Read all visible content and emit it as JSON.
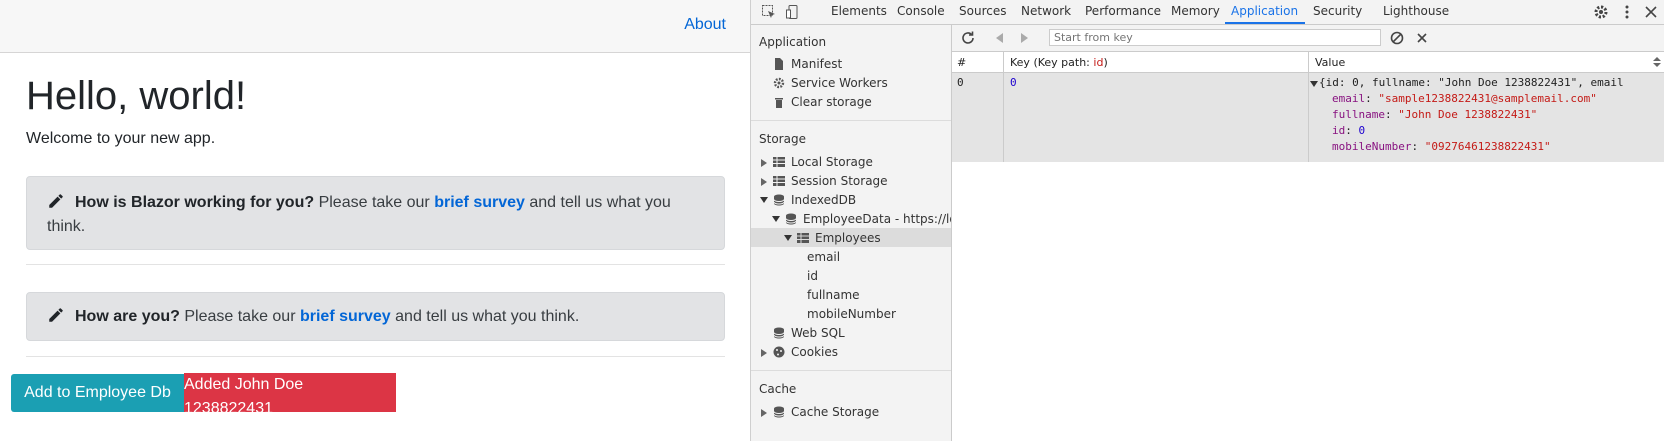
{
  "app": {
    "nav_about": "About",
    "heading": "Hello, world!",
    "welcome": "Welcome to your new app.",
    "alerts": [
      {
        "question": "How is Blazor working for you?",
        "pre": " Please take our ",
        "link": "brief survey",
        "post": " and tell us what you think."
      },
      {
        "question": "How are you?",
        "pre": " Please take our ",
        "link": "brief survey",
        "post": " and tell us what you think."
      }
    ],
    "add_button": "Add to Employee Db",
    "added_message": "Added John Doe 1238822431"
  },
  "devtools": {
    "tabs": [
      "Elements",
      "Console",
      "Sources",
      "Network",
      "Performance",
      "Memory",
      "Application",
      "Security",
      "Lighthouse"
    ],
    "active_tab": "Application",
    "sidebar": {
      "application_title": "Application",
      "application_items": [
        "Manifest",
        "Service Workers",
        "Clear storage"
      ],
      "storage_title": "Storage",
      "storage_items": {
        "local": "Local Storage",
        "session": "Session Storage",
        "indexeddb": "IndexedDB",
        "database": "EmployeeData - https://loca",
        "store": "Employees",
        "indexes": [
          "email",
          "id",
          "fullname",
          "mobileNumber"
        ],
        "websql": "Web SQL",
        "cookies": "Cookies"
      },
      "cache_title": "Cache",
      "cache_items": [
        "Cache Storage"
      ]
    },
    "toolbar": {
      "filter_placeholder": "Start from key"
    },
    "grid": {
      "headers": [
        "#",
        "Key (Key path: ",
        "id",
        ")",
        "Value"
      ],
      "rows": [
        {
          "index": "0",
          "key": "0",
          "summary": "{id: 0, fullname: \"John Doe 1238822431\", email",
          "fields": [
            {
              "name": "email",
              "value": "\"sample1238822431@samplemail.com\"",
              "type": "string"
            },
            {
              "name": "fullname",
              "value": "\"John Doe 1238822431\"",
              "type": "string"
            },
            {
              "name": "id",
              "value": "0",
              "type": "number"
            },
            {
              "name": "mobileNumber",
              "value": "\"09276461238822431\"",
              "type": "string"
            }
          ]
        }
      ]
    }
  }
}
